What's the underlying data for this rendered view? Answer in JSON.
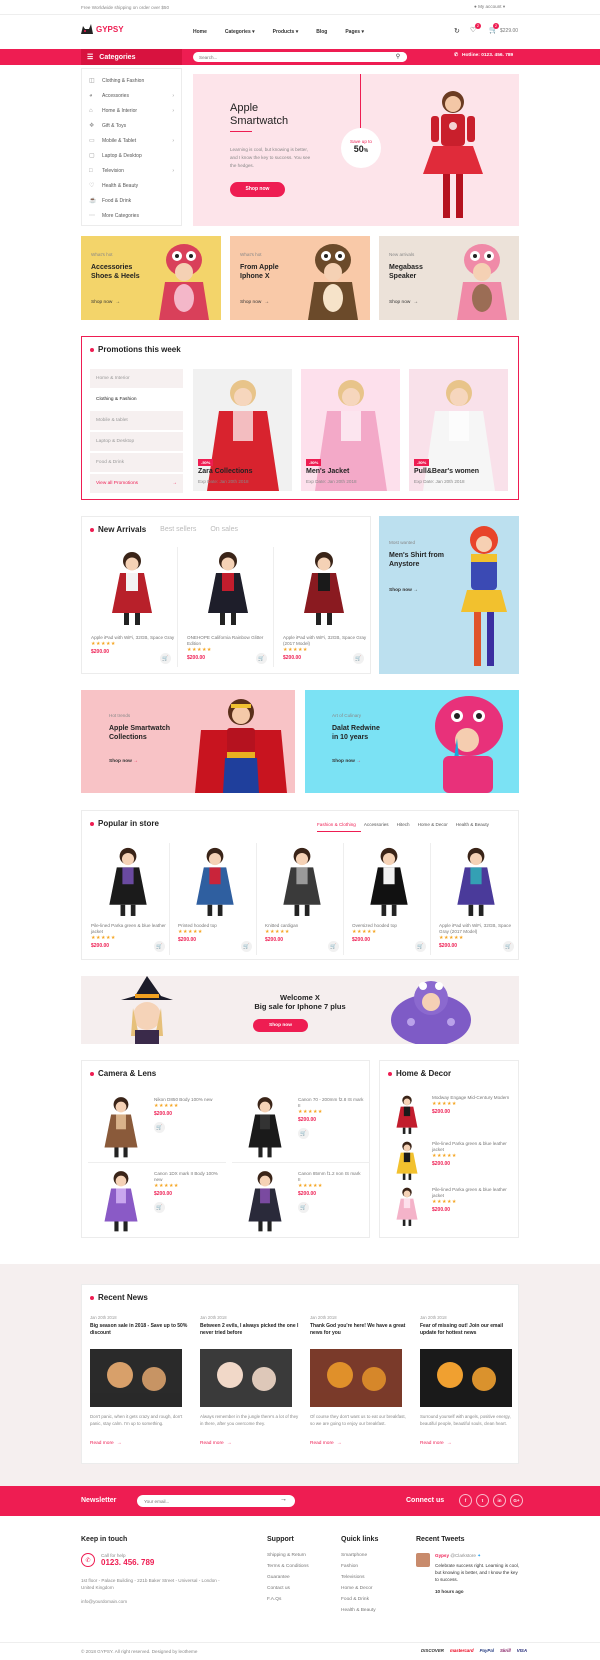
{
  "topbar": {
    "shipping": "Free Worldwide shipping on order over $50",
    "account": "My account"
  },
  "header": {
    "logo": "GYPSY",
    "nav": [
      "Home",
      "Categories",
      "Products",
      "Blog",
      "Pages"
    ],
    "cart_total": "$229.00",
    "wishlist_count": "2",
    "cart_count": "2"
  },
  "catbar": {
    "title": "Categories",
    "search_placeholder": "Search...",
    "hotline": "Hotline: 0123. 456. 789"
  },
  "sidebar": {
    "items": [
      "Clothing & Fashion",
      "Accessories",
      "Home & Interior",
      "Gift & Toys",
      "Mobile & Tablet",
      "Laptop & Desktop",
      "Television",
      "Health & Beauty",
      "Food & Drink",
      "More Categories"
    ]
  },
  "hero": {
    "title1": "Apple",
    "title2": "Smartwatch",
    "desc": "Learning is cool, but knowing is better, and I know the key to success. You see the hedges.",
    "button": "Shop now",
    "badge_top": "Save up to",
    "badge_value": "50",
    "badge_unit": "%"
  },
  "promo_banners": [
    {
      "tag": "What's hot",
      "title1": "Accessories",
      "title2": "Shoes & Heels",
      "link": "Shop now",
      "bg": "#f3d46a"
    },
    {
      "tag": "What's hot",
      "title1": "From Apple",
      "title2": "Iphone X",
      "link": "Shop now",
      "bg": "#f9c9a8"
    },
    {
      "tag": "New arrivals",
      "title1": "Megabass",
      "title2": "Speaker",
      "link": "Shop now",
      "bg": "#ece2d9"
    }
  ],
  "promotions": {
    "title": "Promotions this week",
    "tabs": [
      "Home & Interior",
      "Clothing & Fashion",
      "Mobile & tablet",
      "Laptop & Desktop",
      "Food & Drink"
    ],
    "view_all": "View all Promotions",
    "items": [
      {
        "badge": "-50%",
        "name": "Zara Collections",
        "exp": "Exp Date: Jan 20th 2018"
      },
      {
        "badge": "-50%",
        "name": "Men's Jacket",
        "exp": "Exp Date: Jan 20th 2018"
      },
      {
        "badge": "-50%",
        "name": "Pull&Bear's women",
        "exp": "Exp Date: Jan 20th 2018"
      }
    ]
  },
  "arrivals": {
    "tabs": [
      "New Arrivals",
      "Best sellers",
      "On sales"
    ],
    "products": [
      {
        "name": "Apple iPad with WiFi, 32GB, Space Gray",
        "price": "$200.00"
      },
      {
        "name": "ONEHOPE California Rainbow Glitter Edition",
        "price": "$200.00"
      },
      {
        "name": "Apple iPad with WiFi, 32GB, Space Gray (2017 Model)",
        "price": "$200.00"
      }
    ],
    "side": {
      "tag": "Most wanted",
      "title1": "Men's Shirt from",
      "title2": "Anystore",
      "link": "Shop now"
    }
  },
  "wide_banners": [
    {
      "tag": "Hot trends",
      "title1": "Apple Smartwatch",
      "title2": "Collections",
      "link": "Shop now"
    },
    {
      "tag": "Art of Culinary",
      "title1": "Dalat Redwine",
      "title2": "in 10 years",
      "link": "Shop now"
    }
  ],
  "popular": {
    "title": "Popular in store",
    "tabs": [
      "Fashion & Clothing",
      "Accessories",
      "Hitech",
      "Home & Decor",
      "Health & Beauty"
    ],
    "products": [
      {
        "name": "Pile-lined Parka green & blue leather jacket",
        "price": "$200.00"
      },
      {
        "name": "Printed hooded top",
        "price": "$200.00"
      },
      {
        "name": "Knitted cardigan",
        "price": "$200.00"
      },
      {
        "name": "Oversized hooded top",
        "price": "$200.00"
      },
      {
        "name": "Apple iPad with WiFi, 32GB, Space Gray (2017 Model)",
        "price": "$200.00"
      }
    ]
  },
  "welcome": {
    "line1": "Welcome X",
    "line2": "Big sale for Iphone 7 plus",
    "button": "Shop now"
  },
  "camera": {
    "title": "Camera & Lens",
    "products": [
      {
        "name": "Nikon D850 Body 100% new",
        "price": "$200.00"
      },
      {
        "name": "Canon 70 - 200mm f2.8 IS mark II",
        "price": "$200.00"
      },
      {
        "name": "Canon 1DX mark II Body 100% new",
        "price": "$200.00"
      },
      {
        "name": "Canon 85mm f1.2 non IS mark II",
        "price": "$200.00"
      }
    ]
  },
  "home_decor": {
    "title": "Home & Decor",
    "products": [
      {
        "name": "Modway Engage Mid-Century Modern",
        "price": "$200.00"
      },
      {
        "name": "Pile-lined Parka green & blue leather jacket",
        "price": "$200.00"
      },
      {
        "name": "Pile-lined Parka green & blue leather jacket",
        "price": "$200.00"
      }
    ]
  },
  "news": {
    "title": "Recent News",
    "items": [
      {
        "date": "Jan 20th 2018",
        "title": "Big season sale in 2018 - Save up to 50% discount",
        "body": "Don't panic, when it gets crazy and rough, don't panic, stay calm. I'm up to something.",
        "link": "Read more"
      },
      {
        "date": "Jan 20th 2018",
        "title": "Between 2 evils, I always picked the one I never tried before",
        "body": "Always remember in the jungle there's a lot of they in there, after you overcome they.",
        "link": "Read more"
      },
      {
        "date": "Jan 20th 2018",
        "title": "Thank God you're here! We have a great news for you",
        "body": "Of course they don't want us to eat our breakfast, so we are going to enjoy our breakfast.",
        "link": "Read more"
      },
      {
        "date": "Jan 20th 2018",
        "title": "Fear of missing out! Join our email update for hottest news",
        "body": "Surround yourself with angels, positive energy, beautiful people, beautiful souls, clean heart.",
        "link": "Read more"
      }
    ]
  },
  "newsletter": {
    "label": "Newsletter",
    "placeholder": "Your email...",
    "connect": "Connect us",
    "socials": [
      "f",
      "t",
      "in",
      "G+"
    ]
  },
  "footer": {
    "keep": {
      "title": "Keep in touch",
      "call_label": "Call for help",
      "phone": "0123. 456. 789",
      "address": "1st floor - Palace Building - 221b Baker Street - Universal - London - United Kingdom",
      "email": "info@yourdomain.com"
    },
    "support": {
      "title": "Support",
      "links": [
        "Shipping & Return",
        "Terms & Conditions",
        "Guarantee",
        "Contact us",
        "F.A.Qs"
      ]
    },
    "quick": {
      "title": "Quick links",
      "links": [
        "Smartphone",
        "Fashion",
        "Televisions",
        "Home & Decor",
        "Food & Drink",
        "Health & Beauty"
      ]
    },
    "tweets": {
      "title": "Recent Tweets",
      "user": "Gypsy",
      "handle": "@Clarkstore",
      "text": "Celebrate success right. Learning is cool, but knowing is better, and I know the key to success.",
      "time": "10 hours ago"
    },
    "copyright": "© 2018 GYPSY. All right reserved. Designed by leotheme",
    "payments": [
      "DISCOVER",
      "mastercard",
      "PayPal",
      "Skrill",
      "VISA"
    ]
  },
  "colors": {
    "accent": "#ee1d52",
    "hero_bg": "#fde4ea",
    "light_blue": "#bce0ef",
    "cyan": "#7be2f4",
    "peach": "#f8c3c6"
  }
}
